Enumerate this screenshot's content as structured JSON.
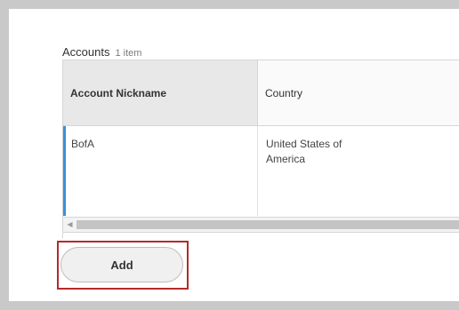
{
  "section": {
    "title": "Accounts",
    "count": "1 item"
  },
  "table": {
    "columns": [
      "Account Nickname",
      "Country"
    ],
    "rows": [
      {
        "nickname": "BofA",
        "country_line1": "United States of",
        "country_line2": "America"
      }
    ]
  },
  "scrollbar": {
    "left_arrow_icon": "chevron-left-icon",
    "left_arrow_glyph": "◀"
  },
  "actions": {
    "add_label": "Add"
  },
  "colors": {
    "row_accent": "#3a8fd8",
    "highlight_border": "#b52a2a",
    "header_bg": "#e8e8e8"
  }
}
